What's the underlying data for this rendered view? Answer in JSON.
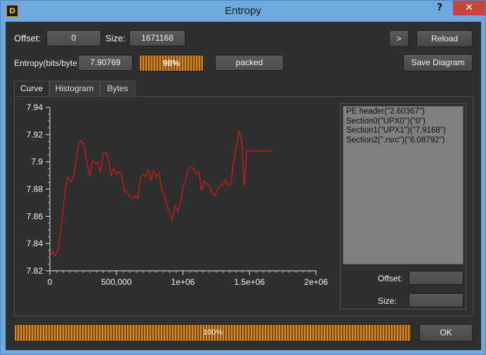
{
  "window": {
    "title": "Entropy",
    "help_label": "?",
    "close_label": "✕",
    "app_icon": "die-icon",
    "app_icon_glyph": "D"
  },
  "header": {
    "offset_label": "Offset:",
    "offset_value": "0",
    "size_label": "Size:",
    "size_value": "1671168",
    "next_label": ">",
    "reload_label": "Reload",
    "entropy_label": "Entropy(bits/byte):",
    "entropy_value": "7.90769",
    "entropy_percent_label": "98%",
    "entropy_percent": 98,
    "status_value": "packed",
    "save_label": "Save Diagram"
  },
  "tabs": [
    {
      "label": "Curve",
      "active": true
    },
    {
      "label": "Histogram",
      "active": false
    },
    {
      "label": "Bytes",
      "active": false
    }
  ],
  "sections": [
    "PE header(\"2.60367\")",
    "Section0(\"UPX0\")(\"0\")",
    "Section1(\"UPX1\")(\"7.9168\")",
    "Section2(\".rsrc\")(\"6.08792\")"
  ],
  "side": {
    "offset_label": "Offset:",
    "offset_value": "",
    "size_label": "Size:",
    "size_value": ""
  },
  "footer": {
    "progress_label": "100%",
    "progress": 100,
    "ok_label": "OK"
  },
  "colors": {
    "curve": "#e01818",
    "background": "#2f2f2f",
    "progress": "#d98a28"
  },
  "chart_data": {
    "type": "line",
    "xlim": [
      0,
      2000000
    ],
    "ylim": [
      7.82,
      7.94
    ],
    "xticks": [
      "0",
      "500,000",
      "1e+06",
      "1.5e+06",
      "2e+06"
    ],
    "yticks": [
      "7.82",
      "7.84",
      "7.86",
      "7.88",
      "7.9",
      "7.92",
      "7.94"
    ],
    "series": [
      {
        "x": [
          0,
          20000,
          40000,
          60000,
          80000,
          100000,
          120000,
          140000,
          160000,
          180000,
          200000,
          220000,
          240000,
          260000,
          280000,
          300000,
          320000,
          340000,
          360000,
          380000,
          400000,
          420000,
          440000,
          460000,
          480000,
          500000,
          520000,
          540000,
          560000,
          580000,
          600000,
          620000,
          640000,
          660000,
          680000,
          700000,
          720000,
          740000,
          760000,
          780000,
          800000,
          820000,
          840000,
          860000,
          880000,
          900000,
          920000,
          940000,
          960000,
          980000,
          1000000,
          1020000,
          1040000,
          1060000,
          1080000,
          1100000,
          1120000,
          1140000,
          1160000,
          1180000,
          1200000,
          1220000,
          1240000,
          1260000,
          1280000,
          1300000,
          1320000,
          1340000,
          1360000,
          1380000,
          1400000,
          1420000,
          1440000,
          1460000,
          1480000,
          1500000,
          1520000,
          1540000,
          1560000,
          1580000,
          1600000,
          1620000,
          1640000,
          1660000,
          1671168
        ],
        "y": [
          7.83,
          7.835,
          7.831,
          7.835,
          7.848,
          7.866,
          7.883,
          7.889,
          7.885,
          7.89,
          7.903,
          7.915,
          7.915,
          7.911,
          7.898,
          7.89,
          7.901,
          7.899,
          7.9,
          7.892,
          7.906,
          7.907,
          7.902,
          7.89,
          7.895,
          7.891,
          7.893,
          7.891,
          7.878,
          7.878,
          7.874,
          7.873,
          7.875,
          7.873,
          7.888,
          7.891,
          7.889,
          7.894,
          7.886,
          7.894,
          7.889,
          7.892,
          7.88,
          7.875,
          7.868,
          7.862,
          7.857,
          7.868,
          7.864,
          7.87,
          7.881,
          7.887,
          7.895,
          7.896,
          7.895,
          7.891,
          7.893,
          7.879,
          7.886,
          7.884,
          7.882,
          7.877,
          7.875,
          7.88,
          7.883,
          7.883,
          7.887,
          7.883,
          7.884,
          7.9,
          7.91,
          7.923,
          7.916,
          7.882,
          7.908,
          7.908,
          7.908,
          7.908,
          7.908,
          7.908,
          7.908,
          7.908,
          7.908,
          7.908,
          7.908
        ]
      }
    ],
    "grid": false,
    "legend": "none"
  }
}
